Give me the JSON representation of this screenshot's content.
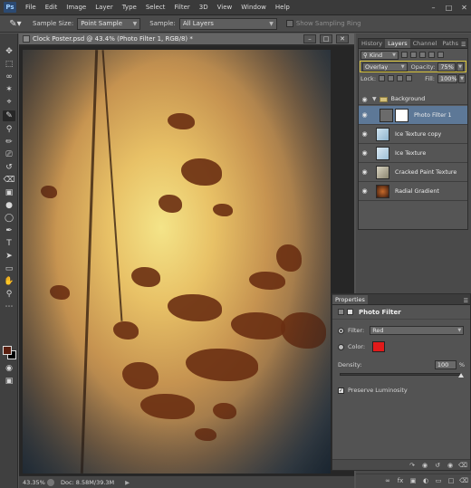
{
  "menubar": {
    "logo": "Ps",
    "items": [
      "File",
      "Edit",
      "Image",
      "Layer",
      "Type",
      "Select",
      "Filter",
      "3D",
      "View",
      "Window",
      "Help"
    ]
  },
  "options": {
    "sample_size_label": "Sample Size:",
    "sample_size_value": "Point Sample",
    "sample_label": "Sample:",
    "sample_value": "All Layers",
    "sampling_ring_label": "Show Sampling Ring"
  },
  "document": {
    "tab_title": "Clock Poster.psd @ 43.4% (Photo Filter 1, RGB/8) *",
    "status_zoom": "43.35%",
    "status_doc": "Doc: 8.58M/39.3M"
  },
  "layers_panel": {
    "tabs": [
      "History",
      "Layers",
      "Channel",
      "Paths"
    ],
    "active_tab": "Layers",
    "kind_label": "Kind",
    "blend_mode": "Overlay",
    "opacity_label": "Opacity:",
    "opacity_value": "75%",
    "lock_label": "Lock:",
    "fill_label": "Fill:",
    "fill_value": "100%",
    "group_name": "Background",
    "layers": [
      {
        "name": "Photo Filter 1",
        "active": true
      },
      {
        "name": "Ice Texture copy",
        "active": false
      },
      {
        "name": "Ice Texture",
        "active": false
      },
      {
        "name": "Cracked Paint Texture",
        "active": false
      },
      {
        "name": "Radial Gradient",
        "active": false
      }
    ]
  },
  "properties_panel": {
    "tab": "Properties",
    "title": "Photo Filter",
    "filter_label": "Filter:",
    "filter_value": "Red",
    "color_label": "Color:",
    "density_label": "Density:",
    "density_value": "100",
    "density_unit": "%",
    "density_level": 1.0,
    "preserve_label": "Preserve Luminosity",
    "preserve_checked": true
  },
  "colors": {
    "filter_color": "#e11a1a",
    "foreground": "#5a1f10",
    "background": "#000000",
    "active_layer": "#5d7897",
    "highlight_border": "#d9c43a"
  },
  "icons": [
    "eyedropper-icon",
    "move-icon",
    "marquee-icon",
    "lasso-icon",
    "quick-select-icon",
    "crop-icon",
    "brush-icon",
    "stamp-icon",
    "eraser-icon",
    "gradient-icon",
    "pen-icon",
    "type-icon",
    "hand-icon",
    "zoom-icon",
    "eye-icon",
    "folder-icon"
  ]
}
